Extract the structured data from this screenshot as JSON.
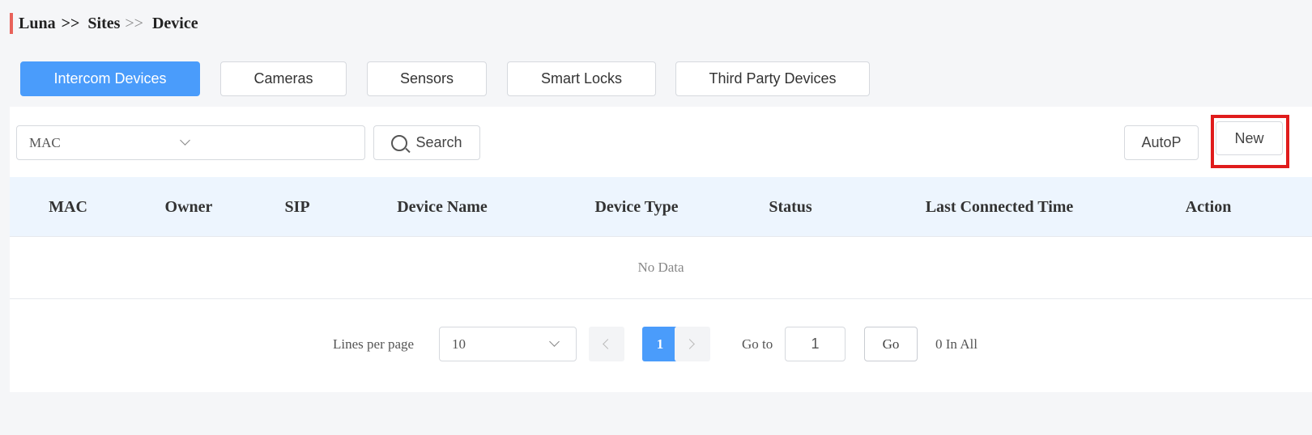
{
  "breadcrumb": {
    "root": "Luna",
    "sep1": ">>",
    "sites": "Sites",
    "sep2": ">>",
    "current": "Device"
  },
  "tabs": [
    {
      "label": "Intercom Devices",
      "active": true
    },
    {
      "label": "Cameras",
      "active": false
    },
    {
      "label": "Sensors",
      "active": false
    },
    {
      "label": "Smart Locks",
      "active": false
    },
    {
      "label": "Third Party Devices",
      "active": false
    }
  ],
  "filter": {
    "field_selected": "MAC",
    "search_value": "",
    "search_label": "Search"
  },
  "actions": {
    "autop_label": "AutoP",
    "new_label": "New"
  },
  "table": {
    "columns": [
      "MAC",
      "Owner",
      "SIP",
      "Device Name",
      "Device Type",
      "Status",
      "Last Connected Time",
      "Action"
    ],
    "empty_text": "No Data"
  },
  "pagination": {
    "lines_label": "Lines per page",
    "page_size": "10",
    "current_page": "1",
    "goto_label": "Go to",
    "goto_value": "1",
    "go_label": "Go",
    "total_text": "0 In All"
  },
  "colors": {
    "accent": "#4a9cfb",
    "highlight": "#e01c1c",
    "breadcrumb_bar": "#e8625a"
  }
}
